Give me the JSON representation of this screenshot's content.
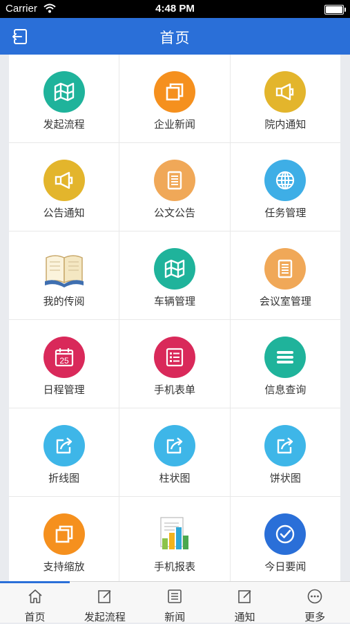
{
  "status_bar": {
    "carrier": "Carrier",
    "time": "4:48 PM",
    "battery_level": 1.0
  },
  "nav": {
    "title": "首页",
    "back_icon": "exit-icon"
  },
  "grid_items": [
    {
      "label": "发起流程",
      "icon": "map-icon",
      "color": "#1fb39b"
    },
    {
      "label": "企业新闻",
      "icon": "square-stack-icon",
      "color": "#f5901e"
    },
    {
      "label": "院内通知",
      "icon": "megaphone-icon",
      "color": "#e3b52c"
    },
    {
      "label": "公告通知",
      "icon": "megaphone-icon",
      "color": "#e3b52c"
    },
    {
      "label": "公文公告",
      "icon": "document-icon",
      "color": "#f0a858"
    },
    {
      "label": "任务管理",
      "icon": "globe-icon",
      "color": "#3eaee6"
    },
    {
      "label": "我的传阅",
      "icon": "open-book-icon",
      "color": "#f3e6c0"
    },
    {
      "label": "车辆管理",
      "icon": "map-icon",
      "color": "#1fb39b"
    },
    {
      "label": "会议室管理",
      "icon": "document-icon",
      "color": "#f0a858"
    },
    {
      "label": "日程管理",
      "icon": "calendar-icon",
      "color": "#d9295a",
      "badge": "25"
    },
    {
      "label": "手机表单",
      "icon": "form-icon",
      "color": "#d9295a"
    },
    {
      "label": "信息查询",
      "icon": "list-icon",
      "color": "#1fb39b"
    },
    {
      "label": "折线图",
      "icon": "share-icon",
      "color": "#3eb6e8"
    },
    {
      "label": "柱状图",
      "icon": "share-icon",
      "color": "#3eb6e8"
    },
    {
      "label": "饼状图",
      "icon": "share-icon",
      "color": "#3eb6e8"
    },
    {
      "label": "支持缩放",
      "icon": "square-stack-icon",
      "color": "#f5901e"
    },
    {
      "label": "手机报表",
      "icon": "report-chart-icon",
      "color": "#4aa84f"
    },
    {
      "label": "今日要闻",
      "icon": "check-circle-icon",
      "color": "#2a6fd8"
    }
  ],
  "tabs": [
    {
      "label": "首页",
      "icon": "home-icon",
      "active": true
    },
    {
      "label": "发起流程",
      "icon": "edit-icon",
      "active": false
    },
    {
      "label": "新闻",
      "icon": "news-icon",
      "active": false
    },
    {
      "label": "通知",
      "icon": "edit-icon",
      "active": false
    },
    {
      "label": "更多",
      "icon": "more-icon",
      "active": false
    }
  ],
  "colors": {
    "accent": "#2a6fd8",
    "grid_bg": "#e8e8e8"
  }
}
